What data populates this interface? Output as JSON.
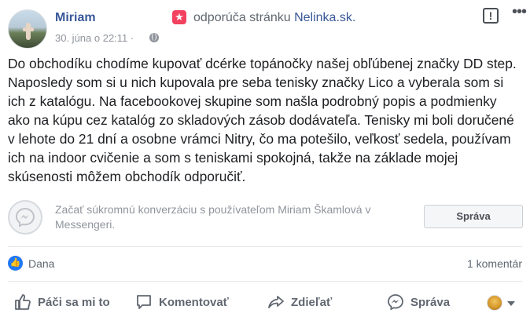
{
  "post": {
    "author": "Miriam",
    "recommendation_prefix": "odporúča stránku",
    "recommended_page": "Nelinka.sk.",
    "timestamp": "30. júna o 22:11",
    "separator": "·",
    "body": "Do obchodíku chodíme kupovať dcérke topánočky našej obľúbenej značky DD step. Naposledy som si u nich kupovala pre seba tenisky značky Lico a vyberala som si ich z katalógu. Na facebookovej skupine som našla podrobný popis a podmienky ako na kúpu cez katalóg zo skladových zásob dodávateľa. Tenisky mi boli doručené v lehote do 21 dní a osobne vrámci Nitry, čo ma potešilo, veľkosť sedela, používam ich na indoor cvičenie a som s teniskami spokojná, takže na základe mojej skúsenosti môžem obchodík odporučiť."
  },
  "messenger": {
    "prompt": "Začať súkromnú konverzáciu s používateľom Miriam Škamlová v Messengeri.",
    "button_label": "Správa"
  },
  "reactions": {
    "likers": "Dana",
    "comment_count": "1 komentár"
  },
  "actions": {
    "like": "Páči sa mi to",
    "comment": "Komentovať",
    "share": "Zdieľať",
    "message": "Správa"
  },
  "colors": {
    "link_blue": "#385898",
    "like_blue": "#2078f4",
    "recommend_red": "#f3425f",
    "meta_gray": "#90949c"
  },
  "icons": {
    "recommend": "star-recommend-icon",
    "privacy": "globe-icon",
    "report": "flag-icon",
    "more": "more-icon",
    "messenger": "messenger-icon"
  }
}
